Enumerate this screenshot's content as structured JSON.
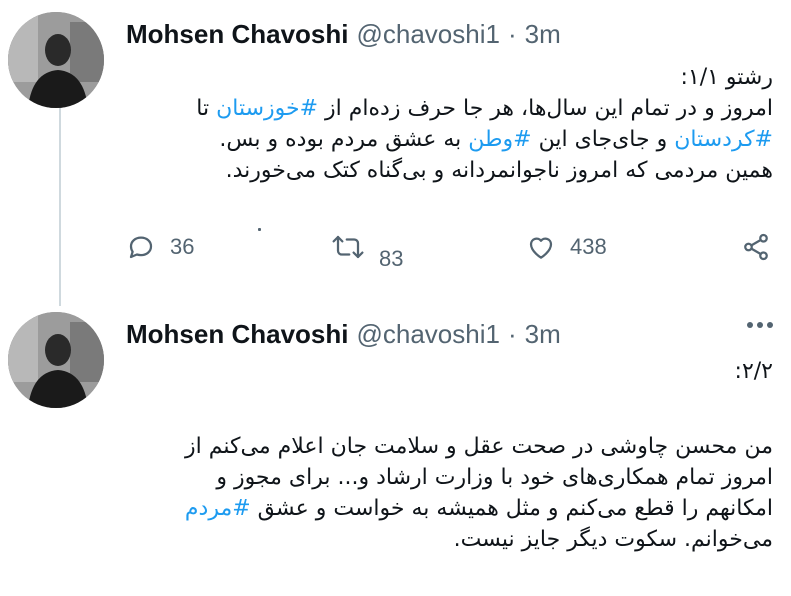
{
  "tweets": [
    {
      "author": {
        "name": "Mohsen Chavoshi",
        "handle": "@chavoshi1",
        "separator": "·",
        "time": "3m"
      },
      "lines": [
        [
          {
            "text": "رشتو ۱/۱:",
            "tag": false
          }
        ],
        [
          {
            "text": "امروز و در تمام این سال‌ها، هر جا حرف زده‌ام از ",
            "tag": false
          },
          {
            "text": "#خوزستان",
            "tag": true
          },
          {
            "text": " تا",
            "tag": false
          }
        ],
        [
          {
            "text": "#کردستان",
            "tag": true
          },
          {
            "text": " و جای‌جای این ",
            "tag": false
          },
          {
            "text": "#وطن",
            "tag": true
          },
          {
            "text": " به عشق مردم بوده و بس.",
            "tag": false
          }
        ],
        [
          {
            "text": "همین مردمی که امروز ناجوانمردانه و بی‌گناه کتک می‌خورند.",
            "tag": false
          }
        ]
      ],
      "actions": {
        "replies": "36",
        "retweets": "83",
        "likes": "438"
      }
    },
    {
      "author": {
        "name": "Mohsen Chavoshi",
        "handle": "@chavoshi1",
        "separator": "·",
        "time": "3m"
      },
      "lines": [
        [
          {
            "text": "۲/۲:",
            "tag": false
          }
        ],
        [],
        [
          {
            "text": "من محسن چاوشی در صحت عقل و سلامت جان اعلام می‌کنم از",
            "tag": false
          }
        ],
        [
          {
            "text": "امروز تمام همکاری‌های خود با وزارت ارشاد و... برای مجوز و",
            "tag": false
          }
        ],
        [
          {
            "text": "امکانهم را قطع می‌کنم و مثل همیشه به خواست و عشق ",
            "tag": false
          },
          {
            "text": "#مردم",
            "tag": true
          }
        ],
        [
          {
            "text": "می‌خوانم. سکوت دیگر جایز نیست.",
            "tag": false
          }
        ]
      ]
    }
  ],
  "icons": {
    "reply": "reply-icon",
    "retweet": "retweet-icon",
    "like": "heart-icon",
    "share": "share-icon",
    "more": "more-icon"
  },
  "colors": {
    "text": "#0f1419",
    "secondary": "#536471",
    "hashtag": "#1d9bf0",
    "thread_line": "#cfd9de"
  }
}
